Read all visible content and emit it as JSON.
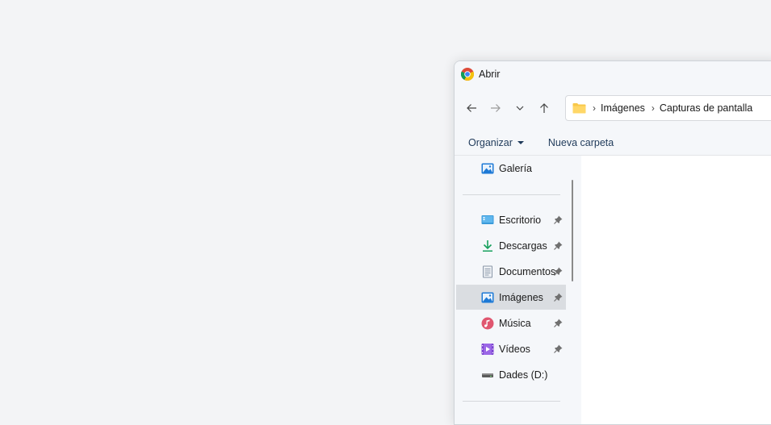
{
  "dialog": {
    "title": "Abrir",
    "app_icon": "chrome-icon"
  },
  "nav": {
    "back": "arrow-left-icon",
    "forward": "arrow-right-icon",
    "recent": "chevron-down-icon",
    "up": "arrow-up-icon"
  },
  "address": {
    "folder_icon": "folder-icon",
    "crumbs": [
      "Imágenes",
      "Capturas de pantalla"
    ]
  },
  "toolbar": {
    "organize_label": "Organizar",
    "new_folder_label": "Nueva carpeta"
  },
  "sidebar": {
    "items": [
      {
        "label": "Galería",
        "icon": "gallery-icon",
        "pinned": false,
        "selected": false
      },
      {
        "label": "Escritorio",
        "icon": "desktop-icon",
        "pinned": true,
        "selected": false
      },
      {
        "label": "Descargas",
        "icon": "download-icon",
        "pinned": true,
        "selected": false
      },
      {
        "label": "Documentos",
        "icon": "document-icon",
        "pinned": true,
        "selected": false
      },
      {
        "label": "Imágenes",
        "icon": "pictures-icon",
        "pinned": true,
        "selected": true
      },
      {
        "label": "Música",
        "icon": "music-icon",
        "pinned": true,
        "selected": false
      },
      {
        "label": "Vídeos",
        "icon": "video-icon",
        "pinned": true,
        "selected": false
      },
      {
        "label": "Dades (D:)",
        "icon": "drive-icon",
        "pinned": false,
        "selected": false
      }
    ]
  },
  "colors": {
    "background": "#f3f4f6",
    "dialog": "#f5f7fa",
    "selected": "#dadde1",
    "accent": "#1f3a5a"
  }
}
